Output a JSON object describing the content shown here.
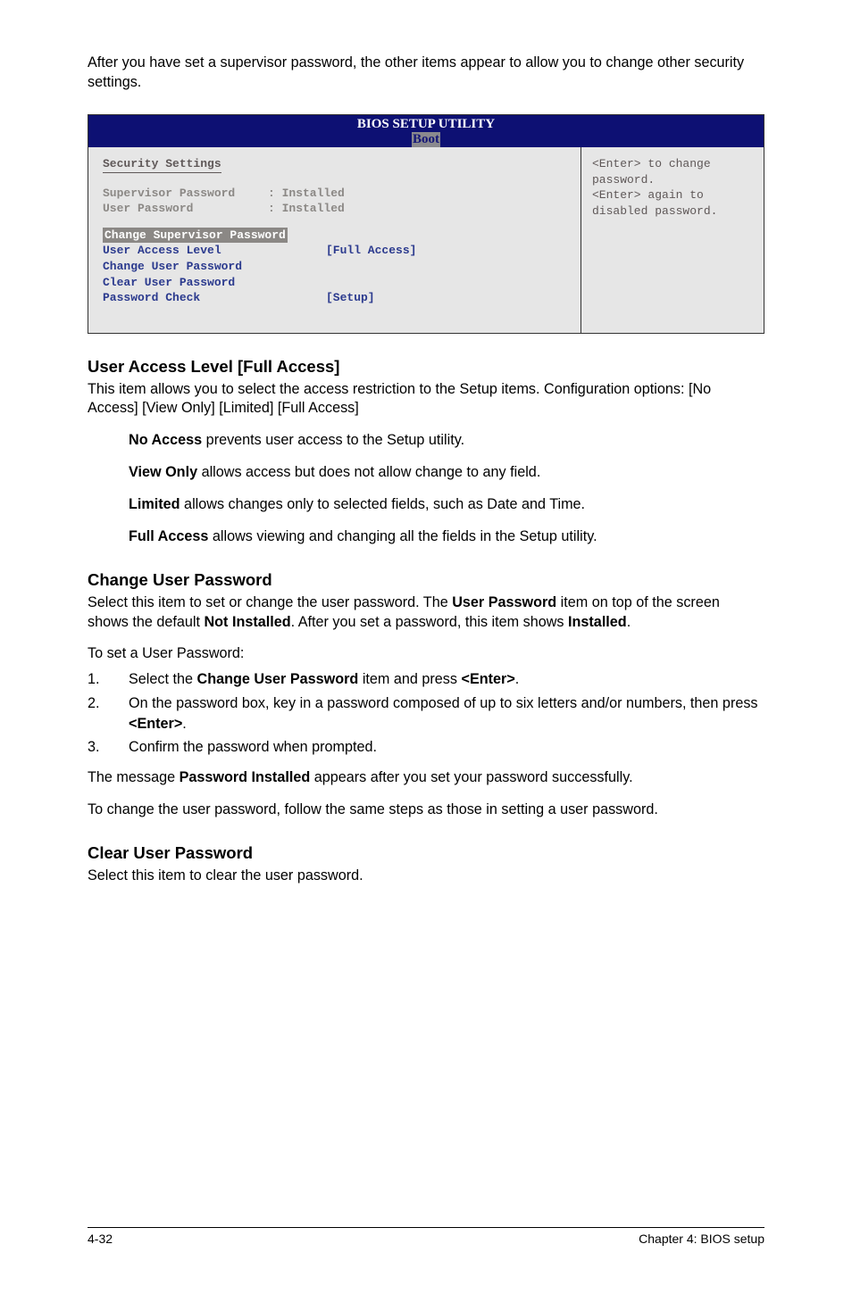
{
  "intro": "After you have set a supervisor password, the other items appear to allow you to change other security settings.",
  "bios": {
    "title_line1": "BIOS SETUP UTILITY",
    "title_line2": "Boot",
    "section_title": "Security Settings",
    "supervisor_label": "Supervisor Password",
    "supervisor_value": ": Installed",
    "user_label": "User Password",
    "user_value": ": Installed",
    "change_sup": "Change Supervisor Password",
    "ual_label": "User Access Level",
    "ual_value": "[Full Access]",
    "change_user": "Change User Password",
    "clear_user": "Clear User Password",
    "pass_check_label": "Password Check",
    "pass_check_value": "[Setup]",
    "help1": "<Enter> to change password.",
    "help2": "<Enter> again to disabled password."
  },
  "ual": {
    "heading": "User Access Level [Full Access]",
    "p1": "This item allows you to select the access restriction to the Setup items. Configuration options: [No Access] [View Only] [Limited] [Full Access]",
    "no_access_b": "No Access",
    "no_access_t": " prevents user access to the Setup utility.",
    "view_only_b": "View Only",
    "view_only_t": " allows access but does not allow change to any field.",
    "limited_b": "Limited",
    "limited_t": " allows changes only to selected fields, such as Date and Time.",
    "full_b": "Full Access",
    "full_t": " allows viewing and changing all the fields in the Setup utility."
  },
  "cup": {
    "heading": "Change User Password",
    "p1a": "Select this item to set or change the user password. The ",
    "p1b": "User Password",
    "p1c": " item on top of the screen shows the default ",
    "p1d": "Not Installed",
    "p1e": ". After you set a password, this item shows ",
    "p1f": "Installed",
    "p1g": ".",
    "p2": "To set a User Password:",
    "s1a": "Select the ",
    "s1b": "Change User Password",
    "s1c": " item and press ",
    "s1d": "<Enter>",
    "s1e": ".",
    "s2a": "On the password box, key in a password composed of up to six letters and/or numbers, then press ",
    "s2b": "<Enter>",
    "s2c": ".",
    "s3": "Confirm the password when prompted.",
    "p3a": "The message ",
    "p3b": "Password Installed",
    "p3c": " appears after you set your password successfully.",
    "p4": "To change the user password, follow the same steps as those in setting a user password."
  },
  "clp": {
    "heading": "Clear User Password",
    "p1": "Select this item to clear the user password."
  },
  "footer": {
    "left": "4-32",
    "right": "Chapter 4: BIOS setup"
  }
}
